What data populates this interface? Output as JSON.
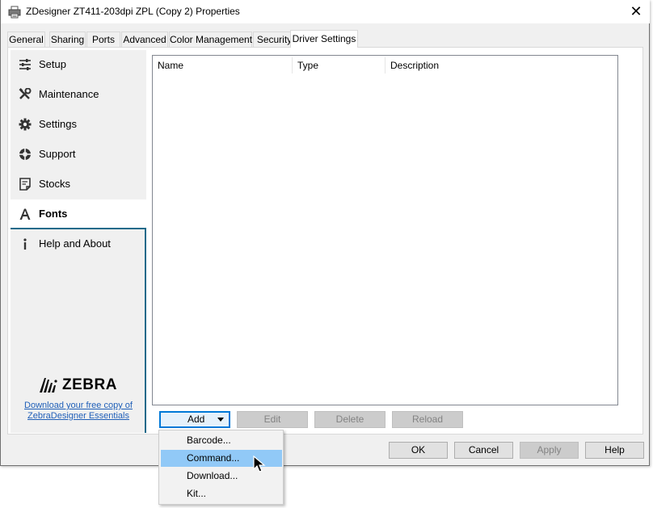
{
  "window": {
    "title": "ZDesigner ZT411-203dpi ZPL (Copy 2) Properties",
    "close_label": "✕"
  },
  "tabs": [
    {
      "label": "General"
    },
    {
      "label": "Sharing"
    },
    {
      "label": "Ports"
    },
    {
      "label": "Advanced"
    },
    {
      "label": "Color Management"
    },
    {
      "label": "Security"
    },
    {
      "label": "Driver Settings",
      "active": true
    }
  ],
  "sidebar": {
    "items": [
      {
        "label": "Setup",
        "icon": "sliders-icon"
      },
      {
        "label": "Maintenance",
        "icon": "tools-icon"
      },
      {
        "label": "Settings",
        "icon": "gear-icon"
      },
      {
        "label": "Support",
        "icon": "lifebuoy-icon"
      },
      {
        "label": "Stocks",
        "icon": "label-stock-icon"
      },
      {
        "label": "Fonts",
        "icon": "font-icon",
        "active": true
      },
      {
        "label": "Help and About",
        "icon": "info-icon"
      }
    ],
    "brand": "ZEBRA",
    "download_link": "Download your free copy of ZebraDesigner Essentials"
  },
  "font_list": {
    "columns": [
      "Name",
      "Type",
      "Description"
    ],
    "rows": []
  },
  "actions": {
    "add": "Add",
    "edit": "Edit",
    "delete": "Delete",
    "reload": "Reload"
  },
  "add_menu": {
    "items": [
      {
        "label": "Barcode..."
      },
      {
        "label": "Command...",
        "hover": true
      },
      {
        "label": "Download..."
      },
      {
        "label": "Kit..."
      }
    ]
  },
  "dialog_buttons": {
    "ok": "OK",
    "cancel": "Cancel",
    "apply": "Apply",
    "help": "Help"
  },
  "colors": {
    "accent": "#0078d7",
    "sidebar_border": "#1b6a8a",
    "menu_hover": "#91c9f7",
    "link": "#1f5fb8"
  }
}
